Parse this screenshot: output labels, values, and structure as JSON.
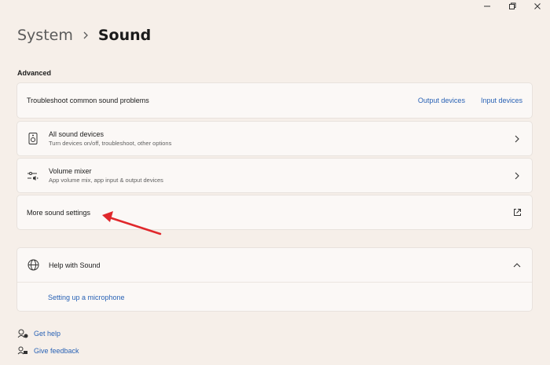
{
  "window": {
    "minimize_glyph": "—",
    "maximize_glyph": "❐",
    "close_glyph": "✕"
  },
  "breadcrumb": {
    "parent": "System",
    "current": "Sound"
  },
  "advanced": {
    "label": "Advanced",
    "troubleshoot": {
      "title": "Troubleshoot common sound problems",
      "output_link": "Output devices",
      "input_link": "Input devices"
    },
    "all_devices": {
      "title": "All sound devices",
      "subtitle": "Turn devices on/off, troubleshoot, other options",
      "icon": "speaker-icon"
    },
    "volume_mixer": {
      "title": "Volume mixer",
      "subtitle": "App volume mix, app input & output devices",
      "icon": "mixer-icon"
    },
    "more_settings": {
      "title": "More sound settings",
      "icon": "external-link-icon"
    }
  },
  "help": {
    "title": "Help with Sound",
    "icon": "globe-icon",
    "link": "Setting up a microphone"
  },
  "footer": {
    "get_help": "Get help",
    "give_feedback": "Give feedback"
  },
  "annotation": {
    "arrow_color": "#e0282c"
  },
  "colors": {
    "background": "#f6efe9",
    "card": "#fbf8f6",
    "link": "#2962b5"
  }
}
